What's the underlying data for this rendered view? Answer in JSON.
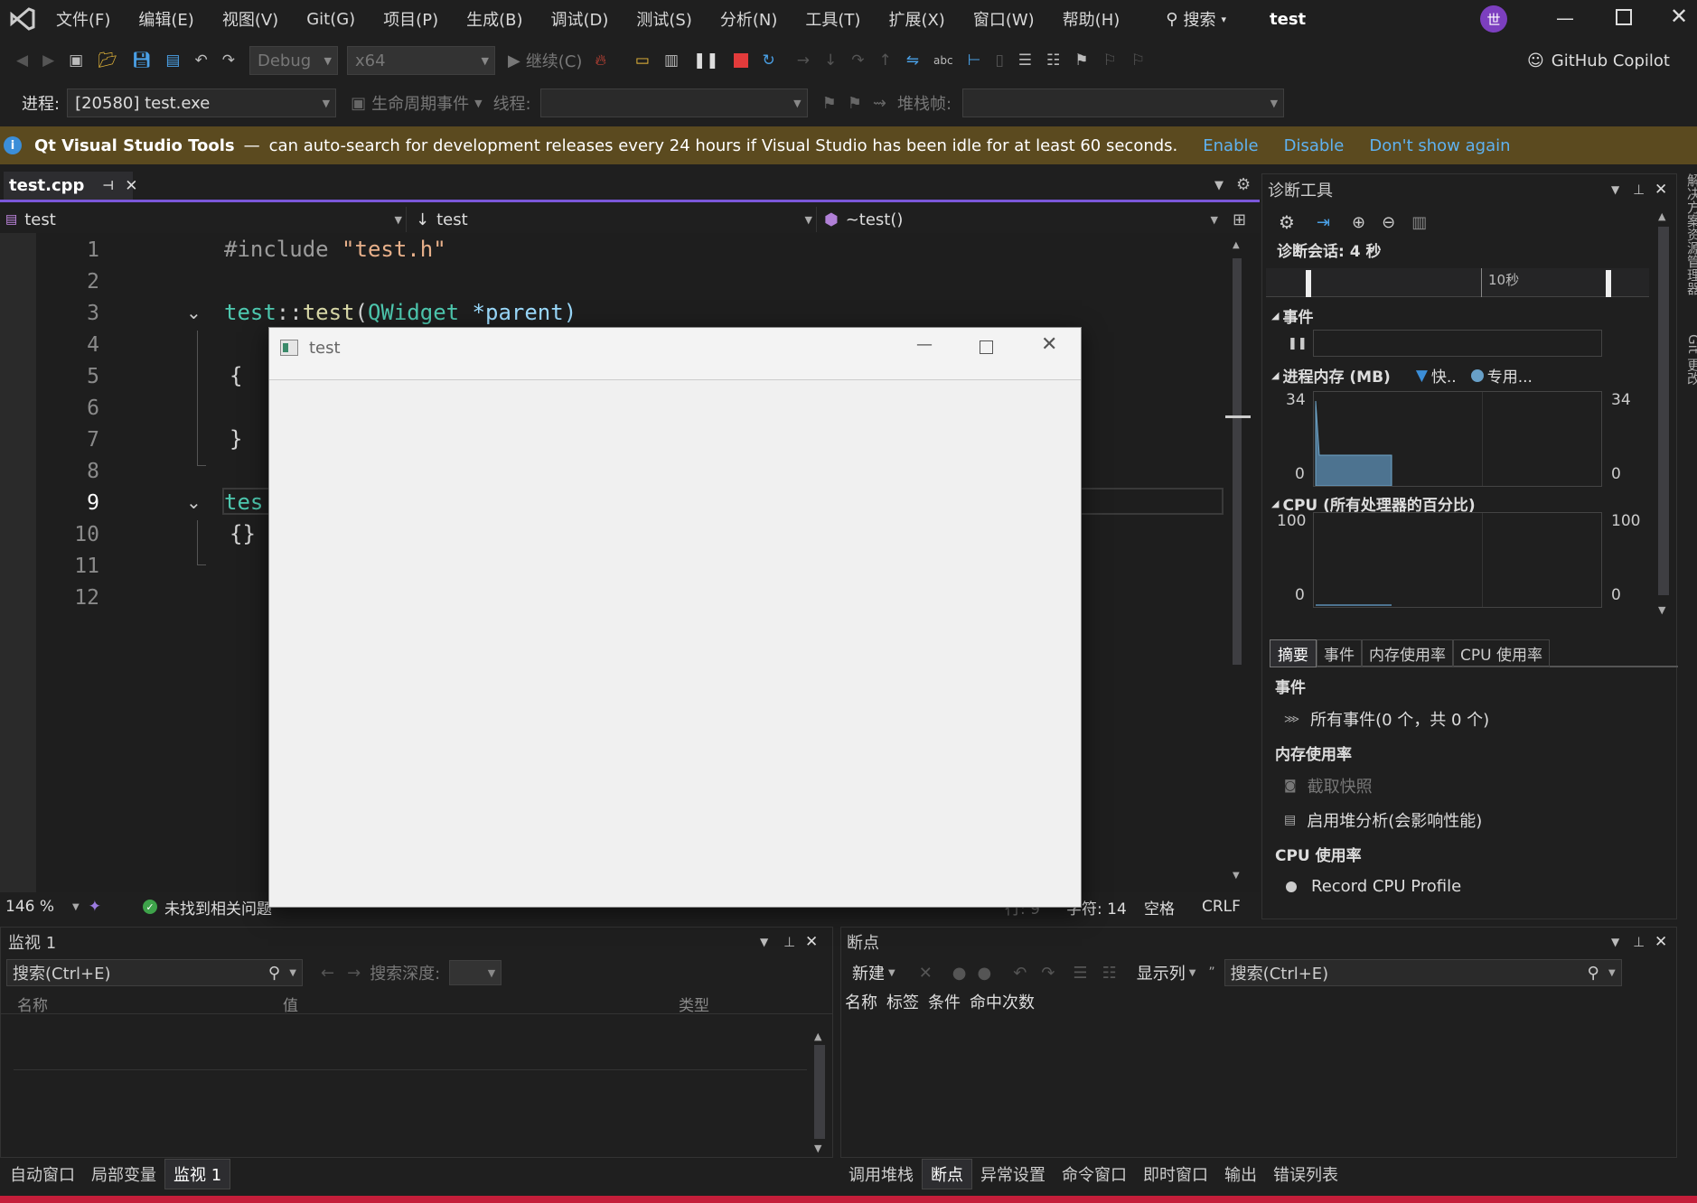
{
  "menu": [
    "文件(F)",
    "编辑(E)",
    "视图(V)",
    "Git(G)",
    "项目(P)",
    "生成(B)",
    "调试(D)",
    "测试(S)",
    "分析(N)",
    "工具(T)",
    "扩展(X)",
    "窗口(W)",
    "帮助(H)"
  ],
  "search_label": "搜索",
  "solution_name": "test",
  "avatar_letter": "世",
  "toolbar": {
    "config": "Debug",
    "platform": "x64",
    "continue": "继续(C)",
    "copilot": "GitHub Copilot"
  },
  "debug_bar": {
    "process_label": "进程:",
    "process_value": "[20580] test.exe",
    "lifecycle": "生命周期事件",
    "thread_label": "线程:",
    "stack_label": "堆栈帧:"
  },
  "infobar": {
    "product": "Qt Visual Studio Tools",
    "dash": "—",
    "message": "can auto-search for development releases every 24 hours if Visual Studio has been idle for at least 60 seconds.",
    "enable": "Enable",
    "disable": "Disable",
    "dont_show": "Don't show again"
  },
  "editor": {
    "tab": "test.cpp",
    "nav_scope": "test",
    "nav_type": "test",
    "nav_member": "~test()",
    "line_numbers": [
      "1",
      "2",
      "3",
      "4",
      "5",
      "6",
      "7",
      "8",
      "9",
      "10",
      "11",
      "12"
    ],
    "line1_kw": "#include ",
    "line1_str": "\"test.h\"",
    "line3_a": "test",
    "line3_b": "::",
    "line3_c": "test",
    "line3_d": "(",
    "line3_e": "QWidget",
    "line3_f": " *parent)",
    "line5": "{",
    "line7": "}",
    "line9": "tes",
    "line10": "{}"
  },
  "status": {
    "zoom": "146 %",
    "issues": "未找到相关问题",
    "line": "行: 9",
    "char": "字符: 14",
    "spaces": "空格",
    "eol": "CRLF"
  },
  "diag": {
    "title": "诊断工具",
    "session": "诊断会话: 4 秒",
    "timeline_tick": "10秒",
    "events_header": "事件",
    "mem_header": "进程内存 (MB)",
    "mem_legend1": "快..",
    "mem_legend2": "专用...",
    "mem_max_left": "34",
    "mem_min_left": "0",
    "mem_max_right": "34",
    "mem_min_right": "0",
    "cpu_header": "CPU (所有处理器的百分比)",
    "cpu_max_left": "100",
    "cpu_min_left": "0",
    "cpu_max_right": "100",
    "cpu_min_right": "0",
    "tabs": [
      "摘要",
      "事件",
      "内存使用率",
      "CPU 使用率"
    ],
    "sec_events": "事件",
    "all_events": "所有事件(0 个，共 0 个)",
    "sec_mem": "内存使用率",
    "snapshot": "截取快照",
    "heap": "启用堆分析(会影响性能)",
    "sec_cpu": "CPU 使用率",
    "record_cpu": "Record CPU Profile",
    "side_label1": "解决方案资源管理器",
    "side_label2": "Git 更改"
  },
  "qt_window": {
    "title": "test"
  },
  "watch": {
    "title": "监视 1",
    "search": "搜索(Ctrl+E)",
    "depth_label": "搜索深度:",
    "cols": [
      "名称",
      "值",
      "类型"
    ]
  },
  "breakpoints": {
    "title": "断点",
    "new_label": "新建",
    "show_cols": "显示列",
    "search": "搜索(Ctrl+E)",
    "cols": [
      "名称",
      "标签",
      "条件",
      "命中次数"
    ]
  },
  "bottom_left_tabs": [
    "自动窗口",
    "局部变量",
    "监视 1"
  ],
  "bottom_right_tabs": [
    "调用堆栈",
    "断点",
    "异常设置",
    "命令窗口",
    "即时窗口",
    "输出",
    "错误列表"
  ],
  "colors": {
    "accent": "#7b57d9",
    "status_red": "#c41e3a",
    "info_bar": "#5b4a1f",
    "link": "#5fb2f0"
  }
}
